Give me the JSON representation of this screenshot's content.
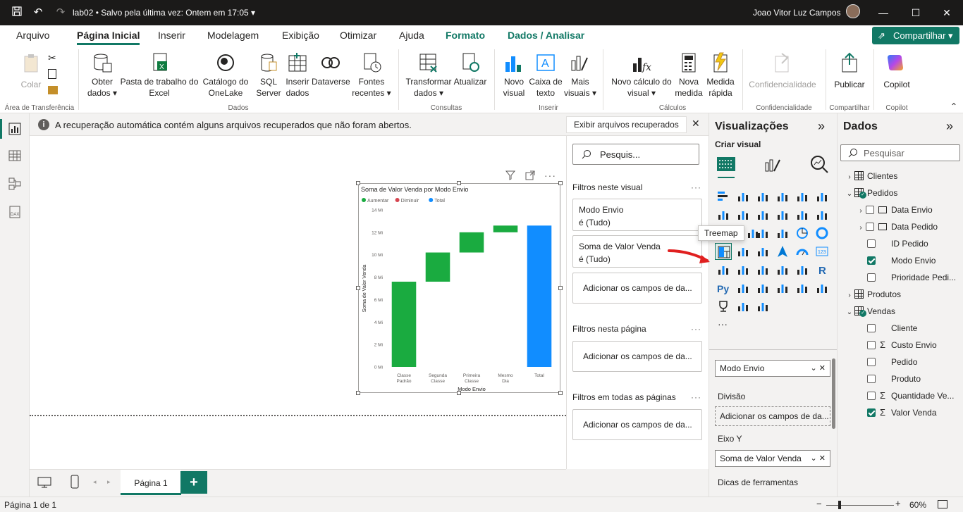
{
  "titlebar": {
    "file_name": "lab02",
    "save_status": "Salvo pela última vez: Ontem em 17:05",
    "user_name": "Joao Vitor Luz Campos"
  },
  "menu": {
    "tabs": [
      "Arquivo",
      "Página Inicial",
      "Inserir",
      "Modelagem",
      "Exibição",
      "Otimizar",
      "Ajuda",
      "Formato",
      "Dados / Analisar"
    ],
    "share_label": "Compartilhar"
  },
  "ribbon": {
    "clipboard": {
      "paste": "Colar",
      "group": "Área de Transferência"
    },
    "data": {
      "get_data": "Obter dados",
      "excel": "Pasta de trabalho do Excel",
      "onelake": "Catálogo do OneLake",
      "sql": "SQL Server",
      "enter_data": "Inserir dados",
      "dataverse": "Dataverse",
      "recent": "Fontes recentes",
      "group": "Dados"
    },
    "queries": {
      "transform": "Transformar dados",
      "refresh": "Atualizar",
      "group": "Consultas"
    },
    "insert": {
      "new_visual": "Novo visual",
      "textbox": "Caixa de texto",
      "more_visuals": "Mais visuais",
      "group": "Inserir"
    },
    "calc": {
      "new_calc": "Novo cálculo do visual",
      "new_measure": "Nova medida",
      "quick_measure": "Medida rápida",
      "group": "Cálculos"
    },
    "sensitivity": {
      "label": "Confidencialidade",
      "group": "Confidencialidade"
    },
    "share": {
      "publish": "Publicar",
      "group": "Compartilhar"
    },
    "copilot": {
      "label": "Copilot",
      "group": "Copilot"
    }
  },
  "notification": {
    "message": "A recuperação automática contém alguns arquivos recuperados que não foram abertos.",
    "button": "Exibir arquivos recuperados"
  },
  "chart_data": {
    "type": "bar",
    "subtype": "waterfall",
    "title": "Soma de Valor Venda por Modo Envio",
    "xlabel": "Modo Envio",
    "ylabel": "Soma de Valor Venda",
    "legend": [
      "Aumentar",
      "Diminuir",
      "Total"
    ],
    "legend_colors": [
      "#1aab40",
      "#d64550",
      "#118dff"
    ],
    "categories": [
      "Classe Padrão",
      "Segunda Classe",
      "Primeira Classe",
      "Mesmo Dia",
      "Total"
    ],
    "y_ticks": [
      "0 Mi",
      "2 Mi",
      "4 Mi",
      "6 Mi",
      "8 Mi",
      "10 Mi",
      "12 Mi",
      "14 Mi"
    ],
    "ylim": [
      0,
      14
    ],
    "steps": [
      {
        "start": 0,
        "end": 7.6,
        "kind": "Aumentar"
      },
      {
        "start": 7.6,
        "end": 10.2,
        "kind": "Aumentar"
      },
      {
        "start": 10.2,
        "end": 12.0,
        "kind": "Aumentar"
      },
      {
        "start": 12.0,
        "end": 12.6,
        "kind": "Aumentar"
      },
      {
        "start": 0,
        "end": 12.6,
        "kind": "Total"
      }
    ],
    "colors": {
      "Aumentar": "#1aab40",
      "Diminuir": "#d64550",
      "Total": "#118dff"
    }
  },
  "filters": {
    "search_placeholder": "Pesquis...",
    "on_visual": "Filtros neste visual",
    "card1_title": "Modo Envio",
    "card1_value": "é (Tudo)",
    "card2_title": "Soma de Valor Venda",
    "card2_value": "é (Tudo)",
    "add_fields": "Adicionar os campos de da...",
    "on_page": "Filtros nesta página",
    "on_all_pages": "Filtros em todas as páginas"
  },
  "visualizations": {
    "title": "Visualizações",
    "build": "Criar visual",
    "tooltip": "Treemap",
    "wells": {
      "category_field": "Modo Envio",
      "breakdown_label": "Divisão",
      "breakdown_add": "Adicionar os campos de da...",
      "y_label": "Eixo Y",
      "y_field": "Soma de Valor Venda",
      "tooltips_label": "Dicas de ferramentas"
    }
  },
  "data_pane": {
    "title": "Dados",
    "search_placeholder": "Pesquisar",
    "tables": {
      "clientes": "Clientes",
      "pedidos": "Pedidos",
      "data_envio": "Data Envio",
      "data_pedido": "Data Pedido",
      "id_pedido": "ID Pedido",
      "modo_envio": "Modo Envio",
      "prioridade": "Prioridade Pedi...",
      "produtos": "Produtos",
      "vendas": "Vendas",
      "cliente": "Cliente",
      "custo_envio": "Custo Envio",
      "pedido": "Pedido",
      "produto": "Produto",
      "quantidade": "Quantidade Ve...",
      "valor_venda": "Valor Venda"
    }
  },
  "pages": {
    "tab": "Página 1"
  },
  "status": {
    "page_info": "Página 1 de 1",
    "zoom": "60%"
  }
}
